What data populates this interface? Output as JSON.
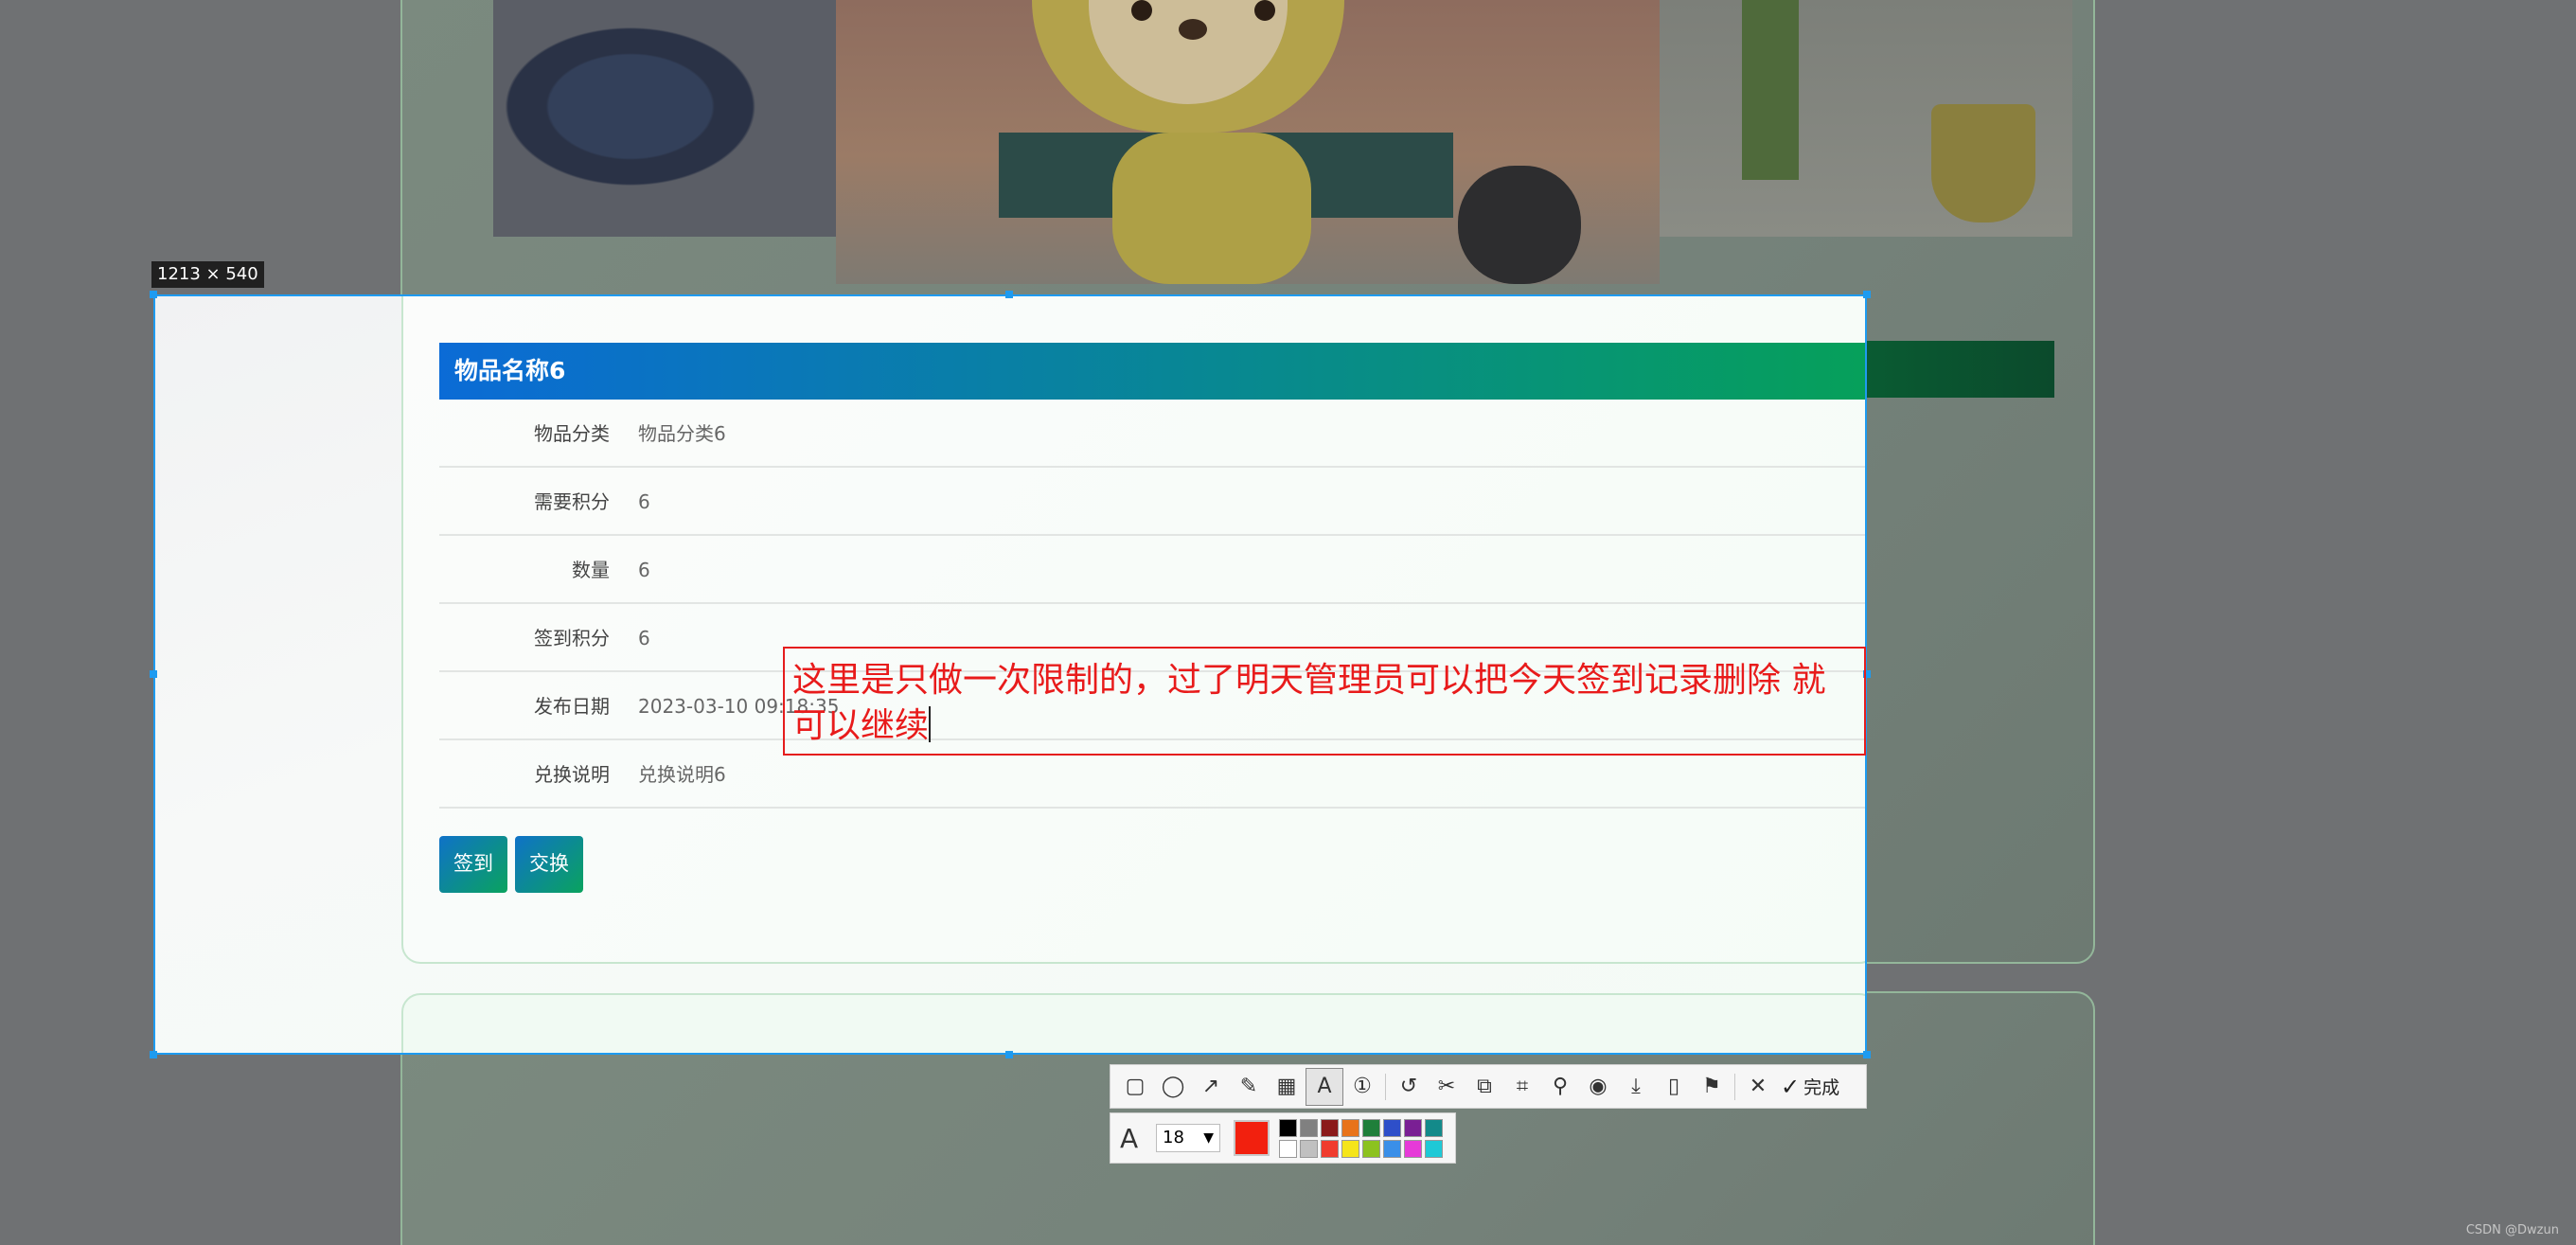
{
  "selection": {
    "size_label": "1213 × 540"
  },
  "item": {
    "title": "物品名称6",
    "fields": [
      {
        "label": "物品分类",
        "value": "物品分类6"
      },
      {
        "label": "需要积分",
        "value": "6"
      },
      {
        "label": "数量",
        "value": "6"
      },
      {
        "label": "签到积分",
        "value": "6"
      },
      {
        "label": "发布日期",
        "value": "2023-03-10 09:18:35"
      },
      {
        "label": "兑换说明",
        "value": "兑换说明6"
      }
    ],
    "buttons": {
      "signin": "签到",
      "exchange": "交换"
    }
  },
  "annotation": {
    "text": "这里是只做一次限制的，过了明天管理员可以把今天签到记录删除 就可以继续",
    "color": "#e81b1b"
  },
  "toolbar": {
    "done_label": "完成",
    "tools": [
      "rectangle-icon",
      "ellipse-icon",
      "arrow-icon",
      "pencil-icon",
      "mosaic-icon",
      "text-icon",
      "number-icon",
      "undo-icon",
      "cut-icon",
      "translate-icon",
      "ocr-icon",
      "pin-icon",
      "record-icon",
      "download-icon",
      "long-screenshot-icon",
      "bookmark-icon",
      "close-icon"
    ]
  },
  "text_options": {
    "font_size": "18",
    "current_color": "#f2200e",
    "palette": [
      "#000000",
      "#808080",
      "#8b1a1a",
      "#e8731a",
      "#1f7f3a",
      "#2e4fc9",
      "#7a1f94",
      "#138a8a",
      "#ffffff",
      "#c0c0c0",
      "#f03c2e",
      "#f5e51a",
      "#8cc21f",
      "#3a8fe8",
      "#e63ad8",
      "#1fc9d6"
    ]
  },
  "watermark": "CSDN @Dwzun"
}
